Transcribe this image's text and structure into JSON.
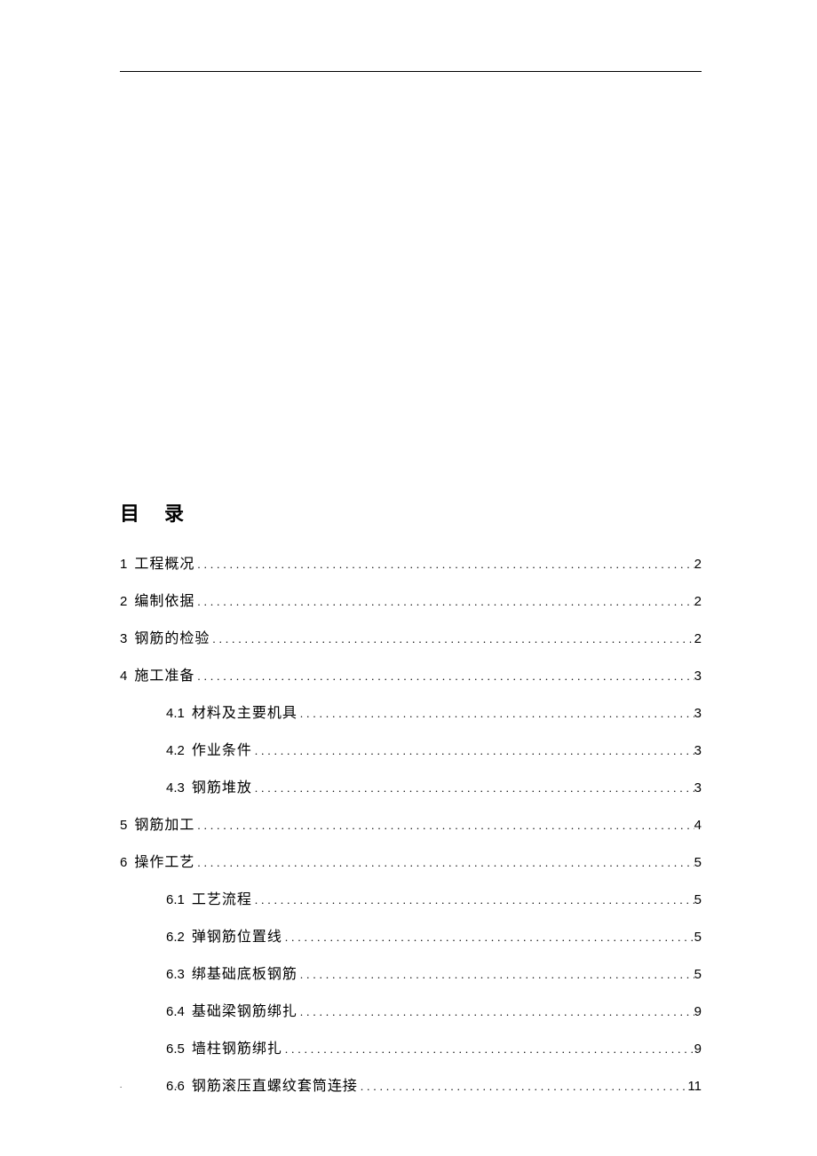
{
  "title": "目录",
  "toc": [
    {
      "num": "1",
      "label": "工程概况",
      "page": "2",
      "level": 1
    },
    {
      "num": "2",
      "label": "编制依据",
      "page": "2",
      "level": 1
    },
    {
      "num": "3",
      "label": "钢筋的检验",
      "page": "2",
      "level": 1
    },
    {
      "num": "4",
      "label": "施工准备",
      "page": "3",
      "level": 1
    },
    {
      "num": "4.1",
      "label": "材料及主要机具",
      "page": "3",
      "level": 2
    },
    {
      "num": "4.2",
      "label": "作业条件",
      "page": "3",
      "level": 2
    },
    {
      "num": "4.3",
      "label": "钢筋堆放",
      "page": "3",
      "level": 2
    },
    {
      "num": "5",
      "label": "钢筋加工",
      "page": "4",
      "level": 1
    },
    {
      "num": "6",
      "label": "操作工艺",
      "page": "5",
      "level": 1
    },
    {
      "num": "6.1",
      "label": "工艺流程",
      "page": "5",
      "level": 2
    },
    {
      "num": "6.2",
      "label": "弹钢筋位置线",
      "page": "5",
      "level": 2
    },
    {
      "num": "6.3",
      "label": "绑基础底板钢筋",
      "page": "5",
      "level": 2
    },
    {
      "num": "6.4",
      "label": "基础梁钢筋绑扎",
      "page": "9",
      "level": 2
    },
    {
      "num": "6.5",
      "label": "墙柱钢筋绑扎",
      "page": "9",
      "level": 2
    },
    {
      "num": "6.6",
      "label": "钢筋滚压直螺纹套筒连接",
      "page": "11",
      "level": 2
    }
  ]
}
